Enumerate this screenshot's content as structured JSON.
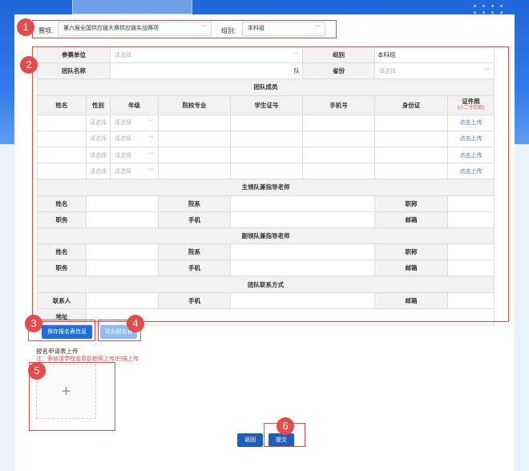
{
  "header": {
    "event_label": "赛项:",
    "event_value": "第六届全国供应链大赛供应链实战赛项",
    "group_label": "组别:",
    "group_value": "本科组"
  },
  "form": {
    "row1": {
      "unit_label": "参赛单位",
      "unit_placeholder": "请选择",
      "group_label": "组别",
      "group_value": "本科组"
    },
    "row2": {
      "team_label": "团队名称",
      "team_suffix": "队",
      "province_label": "省份",
      "province_placeholder": "请选择"
    },
    "members": {
      "section_title": "团队成员",
      "headers": {
        "name": "姓名",
        "gender": "性别",
        "grade": "年级",
        "major": "院校专业",
        "student_id": "学生证号",
        "phone": "手机号",
        "id_card": "身份证",
        "cert": "证件照",
        "cert_note": "(小二寸白底)"
      },
      "gender_placeholder": "请选择",
      "grade_placeholder": "请选择",
      "upload_link": "点击上传"
    },
    "leader": {
      "section_title": "主领队兼指导老师",
      "name": "姓名",
      "dept": "院系",
      "title": "职称",
      "position": "职务",
      "mobile": "手机",
      "email": "邮箱"
    },
    "deputy": {
      "section_title": "副领队兼指导老师",
      "name": "姓名",
      "dept": "院系",
      "title": "职称",
      "position": "职务",
      "mobile": "手机",
      "email": "邮箱"
    },
    "contact": {
      "section_title": "团队联系方式",
      "person": "联系人",
      "mobile": "手机",
      "email": "邮箱",
      "address": "地址"
    }
  },
  "actions": {
    "save_label": "保存报名表信息",
    "export_label": "导出报名表",
    "upload_title": "报名申请表上传",
    "upload_note": "注：表格请学校盖章后拍照上传/扫描上传",
    "upload_plus": "+",
    "back_label": "返回",
    "submit_label": "提交"
  },
  "annotations": {
    "n1": "1",
    "n2": "2",
    "n3": "3",
    "n4": "4",
    "n5": "5",
    "n6": "6"
  },
  "colors": {
    "primary": "#1d6fe0",
    "highlight": "#e84a4a",
    "link": "#2f7cf6",
    "button_dark": "#1d5eb8"
  }
}
